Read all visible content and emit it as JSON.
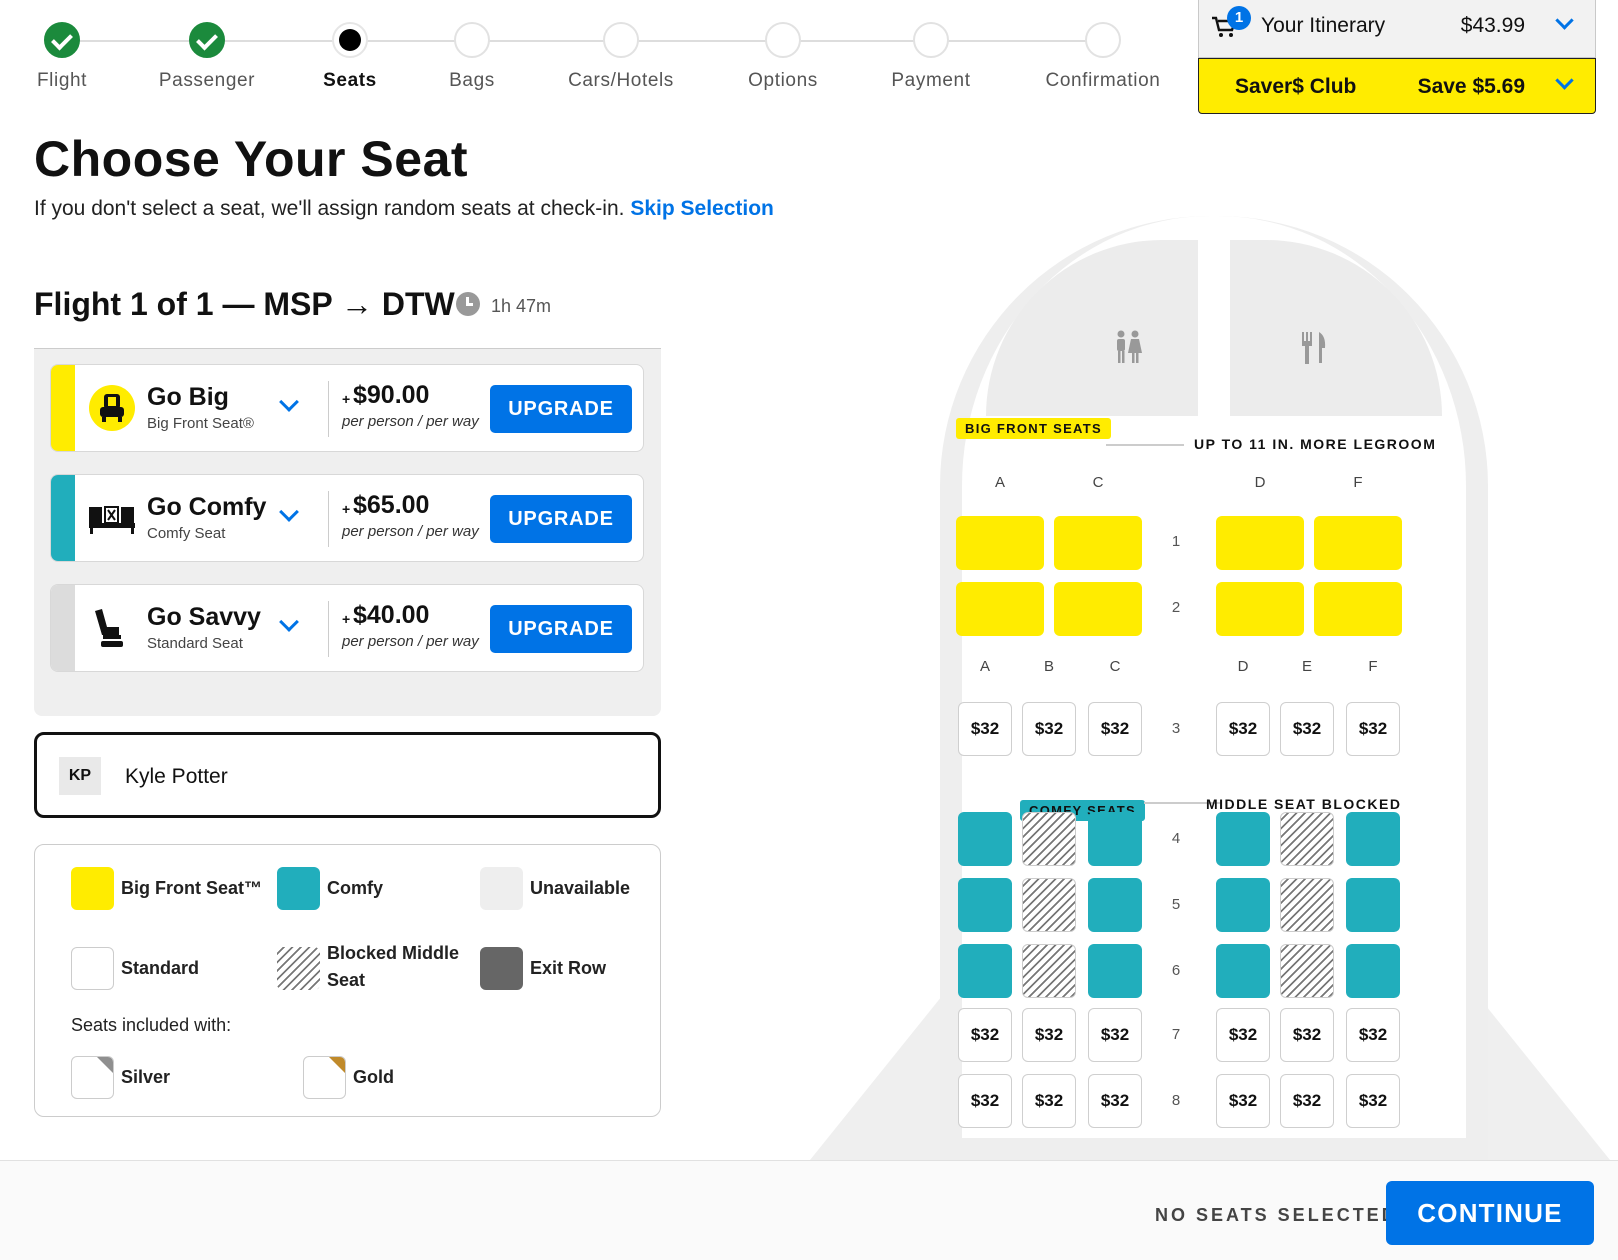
{
  "progress": {
    "steps": [
      {
        "label": "Flight",
        "state": "done"
      },
      {
        "label": "Passenger",
        "state": "done"
      },
      {
        "label": "Seats",
        "state": "current"
      },
      {
        "label": "Bags",
        "state": "todo"
      },
      {
        "label": "Cars/Hotels",
        "state": "todo"
      },
      {
        "label": "Options",
        "state": "todo"
      },
      {
        "label": "Payment",
        "state": "todo"
      },
      {
        "label": "Confirmation",
        "state": "todo"
      }
    ]
  },
  "itinerary": {
    "cart_count": "1",
    "title": "Your Itinerary",
    "price": "$43.99"
  },
  "savers_club": {
    "title": "Saver$ Club",
    "savings": "Save $5.69"
  },
  "page": {
    "title": "Choose Your Seat",
    "subtitle": "If you don't select a seat, we'll assign random seats at check-in.",
    "skip_link": "Skip Selection",
    "flight_title": "Flight 1 of 1 — MSP → DTW",
    "duration": "1h 47m"
  },
  "upgrade_options": [
    {
      "name": "Go Big",
      "subtitle": "Big Front Seat®",
      "plus": "+",
      "price": "$90.00",
      "per": "per person / per way",
      "button": "UPGRADE",
      "color": "#ffec00",
      "icon": "big-seat-icon"
    },
    {
      "name": "Go Comfy",
      "subtitle": "Comfy Seat",
      "plus": "+",
      "price": "$65.00",
      "per": "per person / per way",
      "button": "UPGRADE",
      "color": "#21aebc",
      "icon": "comfy-seat-row-icon"
    },
    {
      "name": "Go Savvy",
      "subtitle": "Standard Seat",
      "plus": "+",
      "price": "$40.00",
      "per": "per person / per way",
      "button": "UPGRADE",
      "color": "#dcdcdc",
      "icon": "standard-seat-icon"
    }
  ],
  "passenger": {
    "initials": "KP",
    "name": "Kyle Potter"
  },
  "legend": {
    "items": [
      {
        "label": "Big Front Seat™",
        "style": "big",
        "color": "#ffec00"
      },
      {
        "label": "Comfy",
        "style": "comfy",
        "color": "#21aebc"
      },
      {
        "label": "Unavailable",
        "style": "unavailable",
        "color": "#eeeeee"
      },
      {
        "label": "Standard",
        "style": "standard",
        "color": "#ffffff"
      },
      {
        "label": "Blocked Middle Seat",
        "style": "blocked",
        "color": "#777777"
      },
      {
        "label": "Exit Row",
        "style": "exit",
        "color": "#666666"
      }
    ],
    "included_label": "Seats included with:",
    "tiers": [
      {
        "label": "Silver",
        "color": "#8f8f8f"
      },
      {
        "label": "Gold",
        "color": "#c08a2a"
      }
    ]
  },
  "seatmap": {
    "big_section": {
      "tag": "BIG FRONT SEATS",
      "note": "UP TO 11 IN. MORE LEGROOM",
      "columns": [
        "A",
        "C",
        "D",
        "F"
      ],
      "rows": [
        "1",
        "2"
      ]
    },
    "main_columns": [
      "A",
      "B",
      "C",
      "D",
      "E",
      "F"
    ],
    "comfy_section": {
      "tag": "COMFY SEATS",
      "note": "MIDDLE SEAT BLOCKED"
    },
    "standard_rows": [
      {
        "row": "3",
        "prices": [
          "$32",
          "$32",
          "$32",
          "$32",
          "$32",
          "$32"
        ]
      },
      {
        "row": "7",
        "prices": [
          "$32",
          "$32",
          "$32",
          "$32",
          "$32",
          "$32"
        ]
      },
      {
        "row": "8",
        "prices": [
          "$32",
          "$32",
          "$32",
          "$32",
          "$32",
          "$32"
        ]
      }
    ],
    "comfy_rows": [
      "4",
      "5",
      "6"
    ],
    "colors": {
      "big": "#ffec00",
      "comfy": "#21aebc"
    }
  },
  "footer": {
    "status": "NO SEATS SELECTED",
    "continue": "CONTINUE"
  }
}
